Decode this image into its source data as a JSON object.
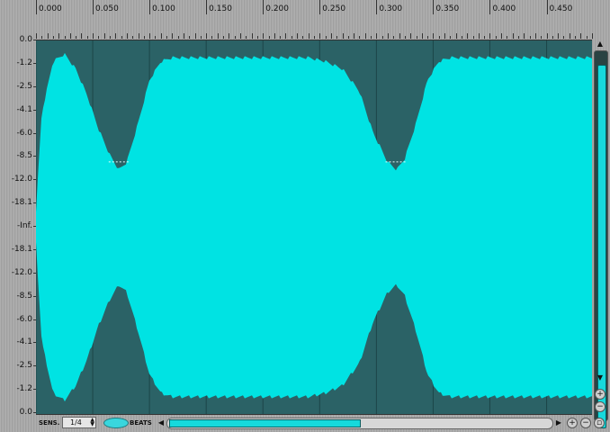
{
  "colors": {
    "waveform": "#00e3e3",
    "wave_background": "#2b6266",
    "app_background": "#a9a9a9",
    "accent": "#16d9dc"
  },
  "ruler": {
    "ticks": [
      "0.000",
      "0.050",
      "0.100",
      "0.150",
      "0.200",
      "0.250",
      "0.300",
      "0.350",
      "0.400",
      "0.450"
    ]
  },
  "db_scale": {
    "labels": [
      "0.0",
      "-1.2",
      "-2.5",
      "-4.1",
      "-6.0",
      "-8.5",
      "-12.0",
      "-18.1",
      "-Inf.",
      "-18.1",
      "-12.0",
      "-8.5",
      "-6.0",
      "-4.1",
      "-2.5",
      "-1.2",
      "0.0"
    ]
  },
  "waveform": {
    "envelope": [
      [
        0.0,
        0.08
      ],
      [
        0.005,
        0.6
      ],
      [
        0.015,
        0.88
      ],
      [
        0.025,
        0.92
      ],
      [
        0.035,
        0.84
      ],
      [
        0.045,
        0.7
      ],
      [
        0.055,
        0.52
      ],
      [
        0.065,
        0.38
      ],
      [
        0.073,
        0.3
      ],
      [
        0.08,
        0.34
      ],
      [
        0.09,
        0.55
      ],
      [
        0.1,
        0.78
      ],
      [
        0.11,
        0.88
      ],
      [
        0.12,
        0.9
      ],
      [
        0.13,
        0.9
      ],
      [
        0.24,
        0.9
      ],
      [
        0.255,
        0.88
      ],
      [
        0.27,
        0.84
      ],
      [
        0.285,
        0.72
      ],
      [
        0.297,
        0.5
      ],
      [
        0.31,
        0.34
      ],
      [
        0.318,
        0.3
      ],
      [
        0.325,
        0.36
      ],
      [
        0.335,
        0.55
      ],
      [
        0.345,
        0.78
      ],
      [
        0.355,
        0.88
      ],
      [
        0.365,
        0.9
      ],
      [
        0.49,
        0.9
      ]
    ],
    "marker_level": 0.35,
    "markers": [
      0.072,
      0.316
    ]
  },
  "bottom_bar": {
    "sens_label": "SENS.",
    "sens_value": "1/4",
    "beats_label": "BEATS"
  },
  "icons": {
    "scroll_up": "triangle-up-icon",
    "scroll_down": "triangle-down-icon",
    "scroll_left": "triangle-left-icon",
    "scroll_right": "triangle-right-icon",
    "zoom_in": "plus-icon",
    "zoom_out": "minus-icon",
    "zoom_fit": "zoom-fit-icon"
  }
}
